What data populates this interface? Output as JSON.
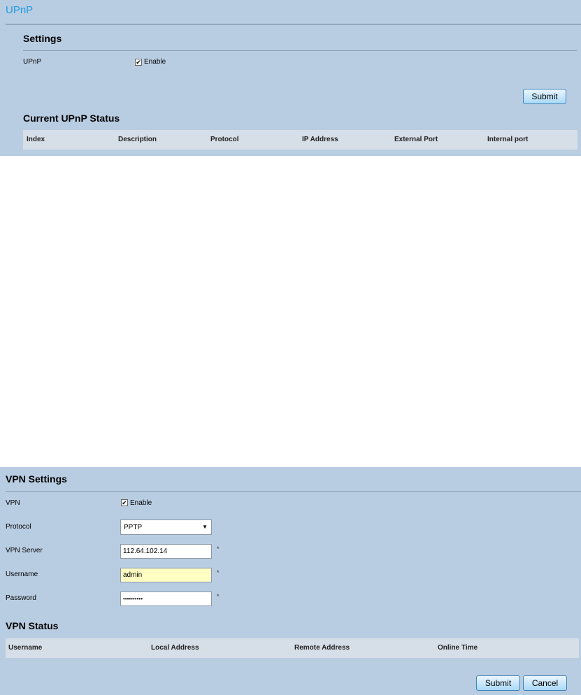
{
  "upnp": {
    "page_title": "UPnP",
    "settings_title": "Settings",
    "upnp_label": "UPnP",
    "enable_checked": "✔",
    "enable_label": "Enable",
    "submit_label": "Submit",
    "status_title": "Current UPnP Status",
    "columns": [
      "Index",
      "Description",
      "Protocol",
      "IP Address",
      "External Port",
      "Internal port"
    ]
  },
  "vpn": {
    "settings_title": "VPN Settings",
    "vpn_label": "VPN",
    "enable_checked": "✔",
    "enable_label": "Enable",
    "protocol_label": "Protocol",
    "protocol_value": "PPTP",
    "server_label": "VPN Server",
    "server_value": "112.64.102.14",
    "username_label": "Username",
    "username_value": "admin",
    "password_label": "Password",
    "password_value": "••••••••••",
    "required_mark": "*",
    "status_title": "VPN Status",
    "columns": [
      "Username",
      "Local Address",
      "Remote Address",
      "Online Time"
    ],
    "submit_label": "Submit",
    "cancel_label": "Cancel"
  },
  "colors": {
    "panel_bg": "#b9cde2",
    "title_blue": "#1e9be0",
    "table_header_bg": "#d6dee7",
    "highlight_input": "#ffffc4"
  }
}
